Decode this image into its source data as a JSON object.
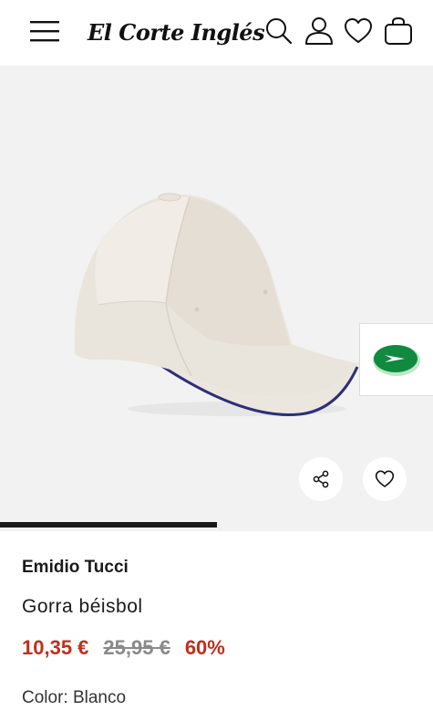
{
  "header": {
    "logo_text": "El Corte Inglés",
    "icons": [
      "menu-icon",
      "search-icon",
      "user-icon",
      "heart-icon",
      "bag-icon"
    ]
  },
  "gallery": {
    "progress": 0.5,
    "actions": [
      "share-icon",
      "heart-icon"
    ],
    "floating_tab_icon": "play-icon"
  },
  "product": {
    "brand": "Emidio Tucci",
    "name": "Gorra béisbol",
    "price_current": "10,35 €",
    "price_original": "25,95 €",
    "discount": "60%",
    "color": "Color: Blanco"
  },
  "colors": {
    "price_red": "#c0301d",
    "brand_green": "#0f8a3f",
    "gallery_bg": "#f2f2f2"
  }
}
